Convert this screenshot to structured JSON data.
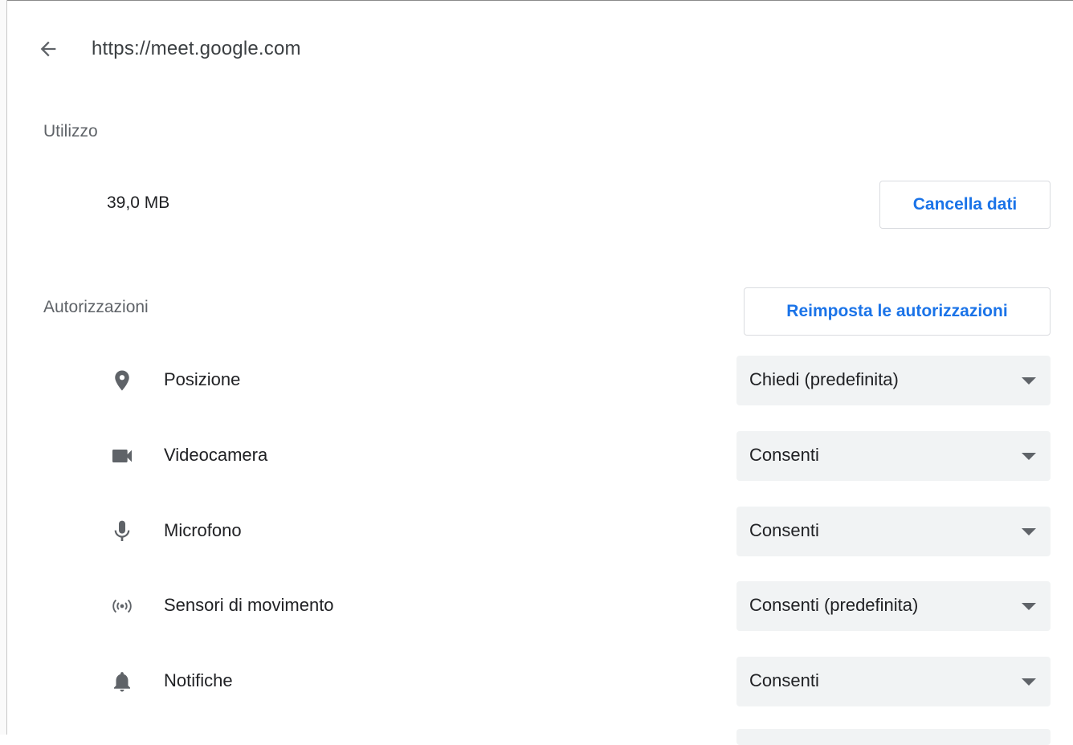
{
  "header": {
    "back_icon": "arrow-left-icon",
    "site_url": "https://meet.google.com"
  },
  "usage": {
    "label": "Utilizzo",
    "value": "39,0 MB",
    "clear_button": "Cancella dati"
  },
  "permissions": {
    "label": "Autorizzazioni",
    "reset_button": "Reimposta le autorizzazioni",
    "items": [
      {
        "icon": "location-pin-icon",
        "label": "Posizione",
        "value": "Chiedi (predefinita)"
      },
      {
        "icon": "videocam-icon",
        "label": "Videocamera",
        "value": "Consenti"
      },
      {
        "icon": "microphone-icon",
        "label": "Microfono",
        "value": "Consenti"
      },
      {
        "icon": "motion-sensors-icon",
        "label": "Sensori di movimento",
        "value": "Consenti (predefinita)"
      },
      {
        "icon": "bell-icon",
        "label": "Notifiche",
        "value": "Consenti"
      }
    ]
  },
  "colors": {
    "accent": "#1a73e8",
    "select_bg": "#f1f3f4",
    "icon": "#5f6368"
  }
}
